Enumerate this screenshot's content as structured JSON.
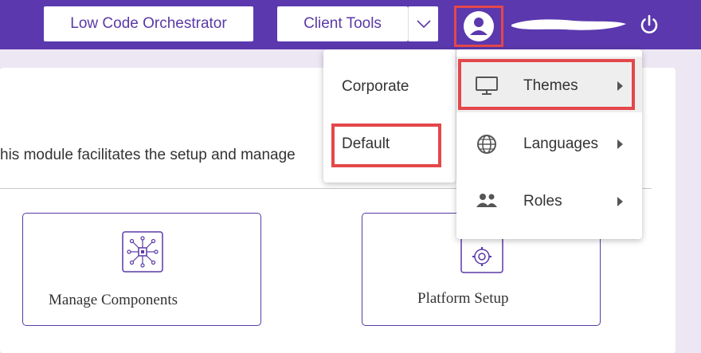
{
  "topbar": {
    "low_code_label": "Low Code Orchestrator",
    "client_tools_label": "Client Tools",
    "icons": {
      "dropdown": "chevron-down-icon",
      "avatar": "user-avatar-icon",
      "power": "power-icon"
    }
  },
  "main": {
    "description": "his module facilitates the setup and manage",
    "tiles": [
      {
        "label": "Manage Components",
        "icon": "components-icon"
      },
      {
        "label": "Platform Setup",
        "icon": "platform-setup-icon"
      }
    ]
  },
  "theme_submenu": {
    "items": [
      {
        "label": "Corporate"
      },
      {
        "label": "Default"
      }
    ]
  },
  "user_menu": {
    "items": [
      {
        "label": "Themes",
        "icon": "monitor-icon"
      },
      {
        "label": "Languages",
        "icon": "globe-icon"
      },
      {
        "label": "Roles",
        "icon": "people-icon"
      }
    ]
  },
  "colors": {
    "brand": "#5b38ae",
    "highlight": "#e4474a",
    "background": "#ede7f3"
  }
}
